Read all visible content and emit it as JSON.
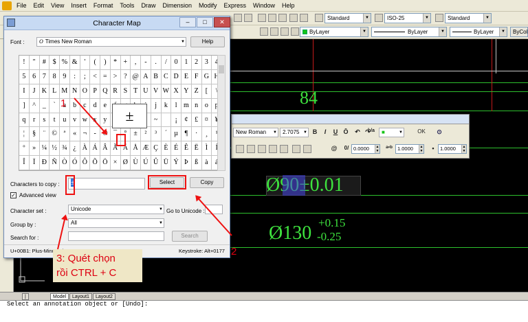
{
  "menubar": {
    "items": [
      "File",
      "Edit",
      "View",
      "Insert",
      "Format",
      "Tools",
      "Draw",
      "Dimension",
      "Modify",
      "Express",
      "Window",
      "Help"
    ]
  },
  "toolbar": {
    "text_style": "Standard",
    "dim_style": "ISO-25",
    "table_style": "Standard",
    "layer_color": "ByLayer",
    "linetype": "ByLayer",
    "lineweight": "ByLayer",
    "plot_color": "ByColor"
  },
  "drawing": {
    "dim_84": "84",
    "dim_phi90_prefix": "Ø90",
    "dim_phi90_suffix": "±0.01",
    "dim_phi130": "Ø130",
    "tol_upper": "+0.15",
    "tol_lower": "-0.25",
    "text_color": "#3ee23e"
  },
  "mtext_toolbar": {
    "font": "New Roman",
    "height": "2.7075",
    "bold": "B",
    "italic": "I",
    "underline": "U",
    "overline": "Ō",
    "undo": "↶",
    "redo": "↷",
    "stack": "b/a",
    "color": "■",
    "ok": "OK",
    "options": "⊙",
    "oblique": "0.0000",
    "tracking": "1.0000",
    "width_factor": "1.0000",
    "symbol": "@",
    "oblique_icon": "0/",
    "tracking_icon": "a•b",
    "width_icon": "•"
  },
  "charmap": {
    "title": "Character Map",
    "font_label": "Font :",
    "font_value": "Times New Roman",
    "help": "Help",
    "chars_to_copy_label": "Characters to copy :",
    "chars_to_copy_value": "±",
    "select": "Select",
    "copy": "Copy",
    "advanced_view": "Advanced view",
    "charset_label": "Character set :",
    "charset_value": "Unicode",
    "goto_unicode_label": "Go to Unicode :",
    "group_by_label": "Group by :",
    "group_by_value": "All",
    "search_for_label": "Search for :",
    "search": "Search",
    "status_left": "U+00B1: Plus-Minus Sign",
    "status_right": "Keystroke: Alt+0177",
    "popup_char": "±",
    "grid_rows": [
      [
        "!",
        "\"",
        "#",
        "$",
        "%",
        "&",
        "'",
        "(",
        ")",
        "*",
        "+",
        ",",
        "-",
        ".",
        "/",
        "0",
        "1",
        "2",
        "3",
        "4"
      ],
      [
        "5",
        "6",
        "7",
        "8",
        "9",
        ":",
        ";",
        "<",
        "=",
        ">",
        "?",
        "@",
        "A",
        "B",
        "C",
        "D",
        "E",
        "F",
        "G",
        "H"
      ],
      [
        "I",
        "J",
        "K",
        "L",
        "M",
        "N",
        "O",
        "P",
        "Q",
        "R",
        "S",
        "T",
        "U",
        "V",
        "W",
        "X",
        "Y",
        "Z",
        "[",
        "\\"
      ],
      [
        "]",
        "^",
        "_",
        "`",
        "a",
        "b",
        "c",
        "d",
        "e",
        "f",
        "g",
        "h",
        "i",
        "j",
        "k",
        "l",
        "m",
        "n",
        "o",
        "p"
      ],
      [
        "q",
        "r",
        "s",
        "t",
        "u",
        "v",
        "w",
        "x",
        "y",
        "z",
        "{",
        "|",
        "}",
        "~",
        " ",
        "¡",
        "¢",
        "£",
        "¤",
        "¥"
      ],
      [
        "¦",
        "§",
        "¨",
        "©",
        "ª",
        "«",
        "¬",
        "-",
        "®",
        "¯",
        "°",
        "±",
        "²",
        "³",
        "´",
        "µ",
        "¶",
        "·",
        "¸",
        "¹"
      ],
      [
        "º",
        "»",
        "¼",
        "½",
        "¾",
        "¿",
        "À",
        "Á",
        "Â",
        "Ã",
        "Ä",
        "Å",
        "Æ",
        "Ç",
        "È",
        "É",
        "Ê",
        "Ë",
        "Ì",
        "Í"
      ],
      [
        "Î",
        "Ï",
        "Ð",
        "Ñ",
        "Ò",
        "Ó",
        "Ô",
        "Õ",
        "Ö",
        "×",
        "Ø",
        "Ù",
        "Ú",
        "Û",
        "Ü",
        "Ý",
        "Þ",
        "ß",
        "à",
        "á"
      ]
    ]
  },
  "annotations": {
    "step1": "1",
    "step2": "2",
    "step3_line1": "3: Quét chọn",
    "step3_line2": "rồi CTRL + C"
  },
  "tabs": [
    "Model",
    "Layout1",
    "Layout2"
  ],
  "command": {
    "line1": "",
    "line2": "Select an annotation object or [Undo]:"
  }
}
